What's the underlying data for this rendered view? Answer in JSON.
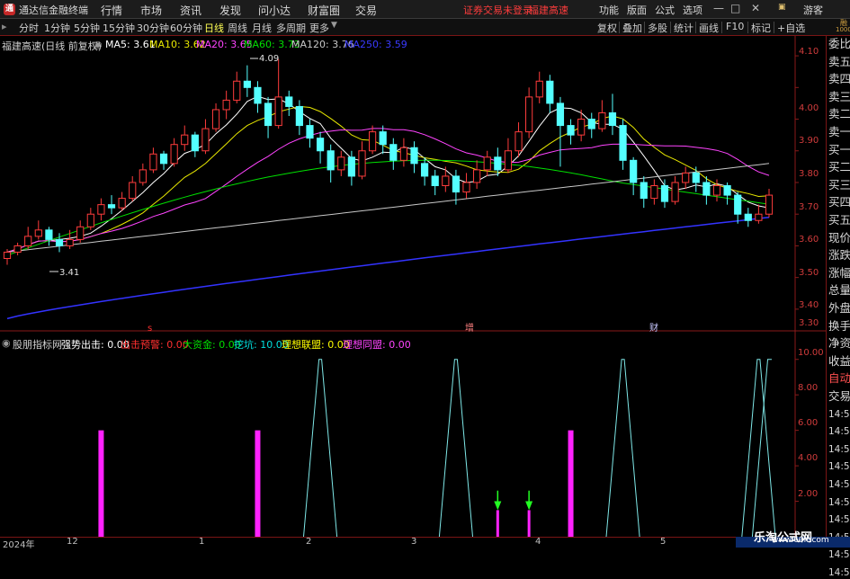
{
  "menubar": {
    "app_title": "通达信金融终端",
    "items": [
      "行情",
      "市场",
      "资讯",
      "发现",
      "问小达",
      "财富圈",
      "交易"
    ],
    "status_text": "证券交易未登录",
    "status_stock": "福建高速",
    "right_items": [
      "功能",
      "版面",
      "公式",
      "选项"
    ],
    "visitor": "游客"
  },
  "toolbar": {
    "periods": [
      "分时",
      "1分钟",
      "5分钟",
      "15分钟",
      "30分钟",
      "60分钟",
      "日线",
      "周线",
      "月线",
      "多周期",
      "更多"
    ],
    "active_period": "日线",
    "right_items": [
      "复权",
      "叠加",
      "多股",
      "统计",
      "画线",
      "F10",
      "标记",
      "+自选"
    ]
  },
  "chart_header": {
    "stock_label": "福建高速(日线 前复权)",
    "ma": [
      {
        "label": "MA5: 3.61",
        "color": "#ffffff"
      },
      {
        "label": "MA10: 3.62",
        "color": "#e8e800"
      },
      {
        "label": "MA20: 3.65",
        "color": "#ff44ff"
      },
      {
        "label": "MA60: 3.73",
        "color": "#00e000"
      },
      {
        "label": "MA120: 3.76",
        "color": "#c8c8c8"
      },
      {
        "label": "MA250: 3.59",
        "color": "#3333ff"
      }
    ]
  },
  "indicator_header": {
    "name": "股朋指标网",
    "lines": [
      {
        "label": "强势出击: 0.00",
        "color": "#ffffff"
      },
      {
        "label": "出击预警: 0.00",
        "color": "#ff3030"
      },
      {
        "label": "大资金: 0.00",
        "color": "#00e000"
      },
      {
        "label": "挖坑: 10.00",
        "color": "#00e0e0"
      },
      {
        "label": "理想联盟: 0.00",
        "color": "#ffff00"
      },
      {
        "label": "理想同盟: 0.00",
        "color": "#ff44ff"
      }
    ]
  },
  "price_axis": [
    "4.10",
    "4.00",
    "3.90",
    "3.80",
    "3.70",
    "3.60",
    "3.50",
    "3.40",
    "3.30"
  ],
  "indicator_axis": [
    "10.00",
    "8.00",
    "6.00",
    "4.00",
    "2.00"
  ],
  "annotations": {
    "high_label": "4.09",
    "low_label": "3.41",
    "event_s": "s",
    "event_zeng": "增",
    "event_cai": "财"
  },
  "sidebar": {
    "top_small": [
      "融",
      "1000"
    ],
    "items": [
      "委比",
      "卖五",
      "卖四",
      "卖三",
      "卖二",
      "卖一",
      "买一",
      "买二",
      "买三",
      "买四",
      "买五",
      "现价",
      "涨跌",
      "涨幅",
      "总量",
      "外盘",
      "换手",
      "净资",
      "收益",
      "自动",
      "交易",
      "14:5",
      "14:5",
      "14:5",
      "14:5",
      "14:5",
      "14:5",
      "14:5",
      "14:5",
      "14:5",
      "14:5"
    ]
  },
  "date_axis": [
    "2024年",
    "12",
    "1",
    "2",
    "3",
    "4",
    "5"
  ],
  "watermark": {
    "title": "乐淘公式网",
    "url": "www.60lt.com"
  },
  "chart_data": {
    "type": "candlestick",
    "price_ylim": [
      3.24,
      4.14
    ],
    "candles": [
      [
        3.46,
        3.48,
        3.44,
        3.49
      ],
      [
        3.48,
        3.5,
        3.47,
        3.51
      ],
      [
        3.5,
        3.53,
        3.49,
        3.56
      ],
      [
        3.53,
        3.55,
        3.52,
        3.58
      ],
      [
        3.55,
        3.52,
        3.5,
        3.56
      ],
      [
        3.52,
        3.5,
        3.48,
        3.54
      ],
      [
        3.5,
        3.52,
        3.49,
        3.55
      ],
      [
        3.52,
        3.56,
        3.51,
        3.58
      ],
      [
        3.56,
        3.6,
        3.55,
        3.62
      ],
      [
        3.6,
        3.63,
        3.58,
        3.65
      ],
      [
        3.63,
        3.62,
        3.6,
        3.66
      ],
      [
        3.62,
        3.65,
        3.61,
        3.67
      ],
      [
        3.65,
        3.7,
        3.64,
        3.72
      ],
      [
        3.7,
        3.74,
        3.69,
        3.76
      ],
      [
        3.74,
        3.79,
        3.73,
        3.81
      ],
      [
        3.79,
        3.76,
        3.74,
        3.8
      ],
      [
        3.76,
        3.82,
        3.75,
        3.84
      ],
      [
        3.82,
        3.85,
        3.8,
        3.88
      ],
      [
        3.85,
        3.8,
        3.78,
        3.86
      ],
      [
        3.8,
        3.87,
        3.79,
        3.9
      ],
      [
        3.87,
        3.93,
        3.86,
        3.95
      ],
      [
        3.93,
        3.96,
        3.9,
        3.99
      ],
      [
        3.96,
        4.02,
        3.95,
        4.05
      ],
      [
        4.02,
        4.0,
        3.97,
        4.07
      ],
      [
        4.0,
        3.95,
        3.92,
        4.02
      ],
      [
        3.95,
        3.88,
        3.84,
        3.97
      ],
      [
        3.88,
        3.97,
        3.87,
        4.09
      ],
      [
        3.97,
        3.94,
        3.91,
        3.99
      ],
      [
        3.94,
        3.88,
        3.85,
        3.96
      ],
      [
        3.88,
        3.84,
        3.81,
        3.9
      ],
      [
        3.84,
        3.8,
        3.76,
        3.86
      ],
      [
        3.8,
        3.74,
        3.7,
        3.82
      ],
      [
        3.74,
        3.78,
        3.72,
        3.8
      ],
      [
        3.78,
        3.72,
        3.69,
        3.8
      ],
      [
        3.72,
        3.8,
        3.71,
        3.83
      ],
      [
        3.8,
        3.86,
        3.79,
        3.88
      ],
      [
        3.86,
        3.82,
        3.79,
        3.88
      ],
      [
        3.82,
        3.77,
        3.74,
        3.84
      ],
      [
        3.77,
        3.81,
        3.75,
        3.84
      ],
      [
        3.81,
        3.76,
        3.73,
        3.83
      ],
      [
        3.76,
        3.72,
        3.69,
        3.78
      ],
      [
        3.72,
        3.69,
        3.66,
        3.74
      ],
      [
        3.69,
        3.72,
        3.67,
        3.75
      ],
      [
        3.72,
        3.67,
        3.63,
        3.74
      ],
      [
        3.67,
        3.7,
        3.65,
        3.73
      ],
      [
        3.7,
        3.74,
        3.68,
        3.77
      ],
      [
        3.74,
        3.78,
        3.72,
        3.8
      ],
      [
        3.78,
        3.74,
        3.72,
        3.81
      ],
      [
        3.74,
        3.8,
        3.73,
        3.84
      ],
      [
        3.8,
        3.86,
        3.78,
        3.89
      ],
      [
        3.86,
        3.97,
        3.84,
        4.0
      ],
      [
        3.97,
        4.02,
        3.95,
        4.05
      ],
      [
        4.02,
        3.95,
        3.92,
        4.04
      ],
      [
        3.95,
        3.88,
        3.75,
        3.97
      ],
      [
        3.88,
        3.85,
        3.82,
        3.9
      ],
      [
        3.85,
        3.9,
        3.83,
        3.93
      ],
      [
        3.9,
        3.87,
        3.84,
        3.92
      ],
      [
        3.87,
        3.92,
        3.86,
        3.96
      ],
      [
        3.92,
        3.88,
        3.85,
        3.98
      ],
      [
        3.88,
        3.77,
        3.74,
        3.9
      ],
      [
        3.77,
        3.7,
        3.66,
        3.78
      ],
      [
        3.7,
        3.65,
        3.62,
        3.72
      ],
      [
        3.65,
        3.69,
        3.63,
        3.71
      ],
      [
        3.69,
        3.64,
        3.62,
        3.71
      ],
      [
        3.64,
        3.7,
        3.63,
        3.72
      ],
      [
        3.7,
        3.73,
        3.68,
        3.75
      ],
      [
        3.73,
        3.7,
        3.67,
        3.75
      ],
      [
        3.7,
        3.66,
        3.63,
        3.72
      ],
      [
        3.66,
        3.69,
        3.64,
        3.71
      ],
      [
        3.69,
        3.66,
        3.63,
        3.7
      ],
      [
        3.66,
        3.6,
        3.57,
        3.67
      ],
      [
        3.6,
        3.58,
        3.56,
        3.62
      ],
      [
        3.58,
        3.6,
        3.57,
        3.63
      ],
      [
        3.6,
        3.66,
        3.59,
        3.68
      ]
    ],
    "indicator_ylim": [
      0,
      11
    ],
    "magenta_bars": [
      9,
      24,
      54
    ],
    "cyan_spikes": [
      30,
      43,
      59,
      72
    ],
    "green_arrows": [
      47,
      50
    ]
  }
}
